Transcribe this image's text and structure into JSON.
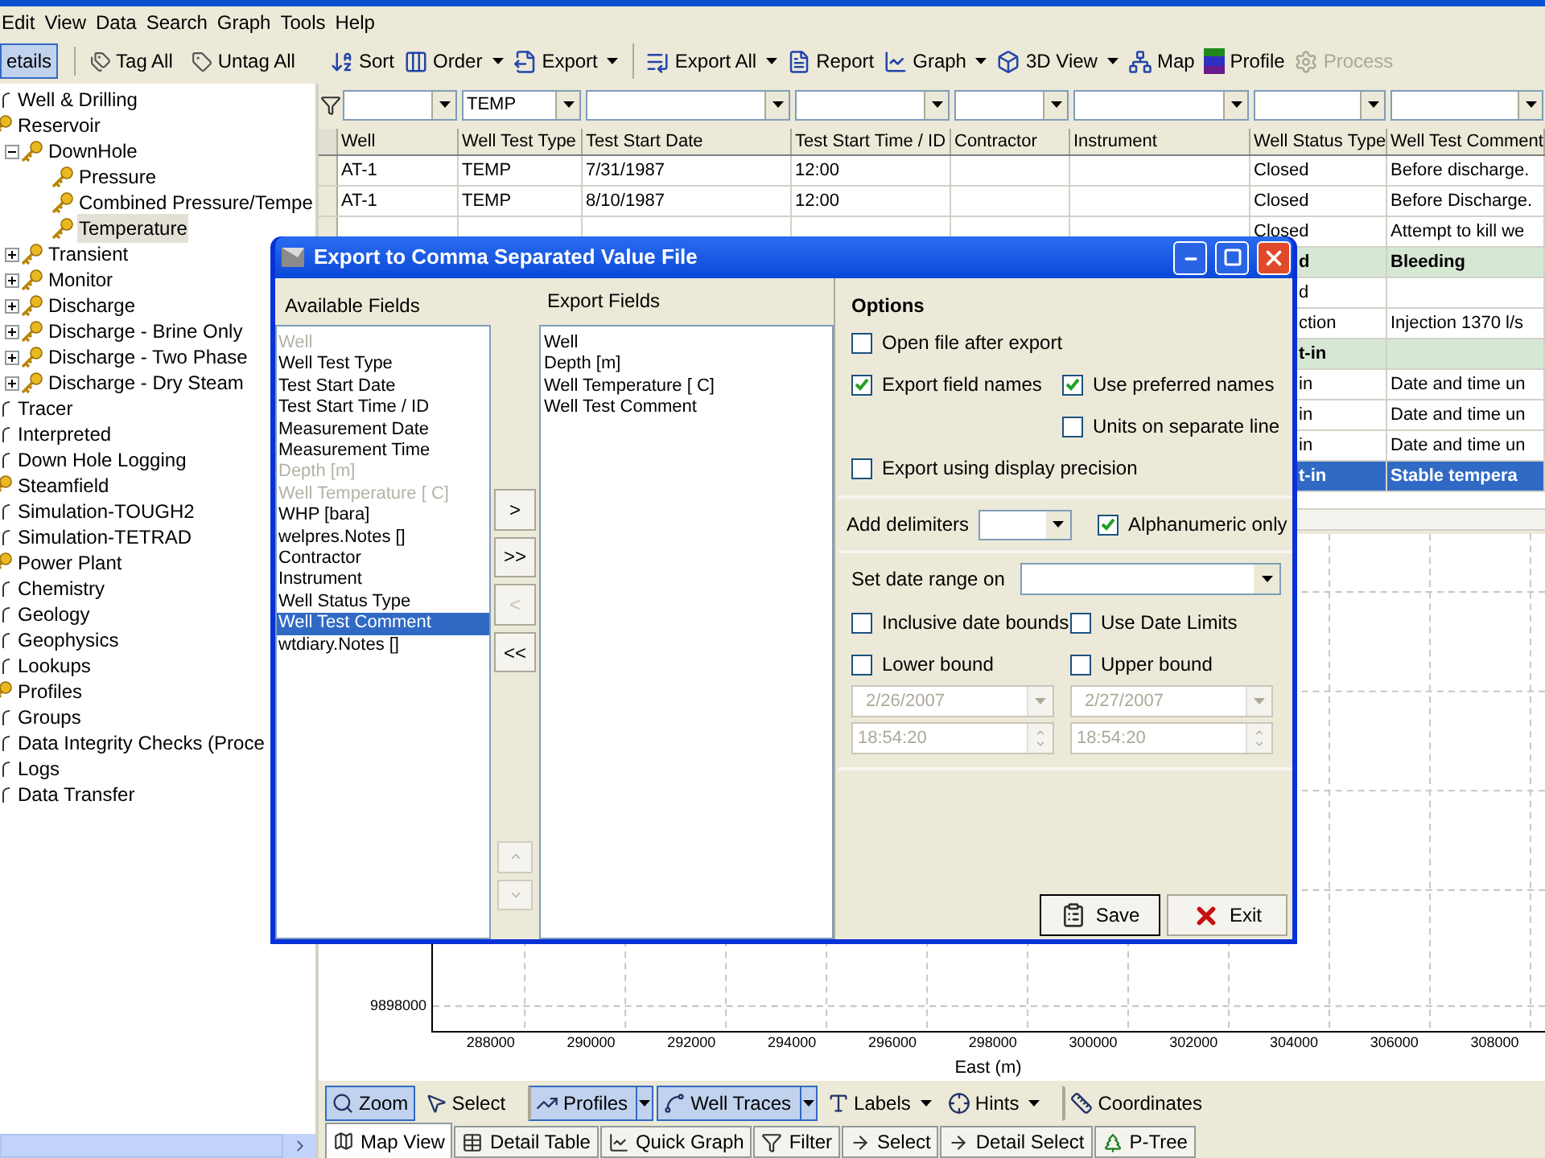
{
  "menu": [
    "Edit",
    "View",
    "Data",
    "Search",
    "Graph",
    "Tools",
    "Help"
  ],
  "side_toolbar": [
    {
      "label": "etails",
      "pressed": true
    },
    {
      "label": "Tag All",
      "pressed": false
    },
    {
      "label": "Untag All",
      "pressed": false
    }
  ],
  "toolbar": [
    {
      "label": "Sort",
      "dropdown": false,
      "disabled": false,
      "separator_before": false
    },
    {
      "label": "Order",
      "dropdown": true,
      "disabled": false,
      "separator_before": false
    },
    {
      "label": "Export",
      "dropdown": true,
      "disabled": false,
      "separator_before": false
    },
    {
      "label": "Export All",
      "dropdown": true,
      "disabled": false,
      "separator_before": true
    },
    {
      "label": "Report",
      "dropdown": false,
      "disabled": false,
      "separator_before": false
    },
    {
      "label": "Graph",
      "dropdown": true,
      "disabled": false,
      "separator_before": false
    },
    {
      "label": "3D View",
      "dropdown": true,
      "disabled": false,
      "separator_before": false
    },
    {
      "label": "Map",
      "dropdown": false,
      "disabled": false,
      "separator_before": false
    },
    {
      "label": "Profile",
      "dropdown": false,
      "disabled": false,
      "separator_before": false
    },
    {
      "label": "Process",
      "dropdown": false,
      "disabled": true,
      "separator_before": false
    }
  ],
  "tree": [
    {
      "label": "Well & Drilling",
      "kind": "branch",
      "selected": false
    },
    {
      "label": "Reservoir",
      "kind": "key",
      "selected": false,
      "children": [
        {
          "label": "DownHole",
          "kind": "key",
          "selected": false,
          "expanded": true,
          "children": [
            {
              "label": "Pressure",
              "kind": "key",
              "selected": false
            },
            {
              "label": "Combined Pressure/Tempe",
              "kind": "key",
              "selected": false
            },
            {
              "label": "Temperature",
              "kind": "key",
              "selected": true
            }
          ]
        },
        {
          "label": "Transient",
          "kind": "key",
          "selected": false,
          "expanded": false
        },
        {
          "label": "Monitor",
          "kind": "key",
          "selected": false,
          "expanded": false
        },
        {
          "label": "Discharge",
          "kind": "key",
          "selected": false,
          "expanded": false
        },
        {
          "label": "Discharge - Brine Only",
          "kind": "key",
          "selected": false,
          "expanded": false
        },
        {
          "label": "Discharge - Two Phase",
          "kind": "key",
          "selected": false,
          "expanded": false
        },
        {
          "label": "Discharge - Dry Steam",
          "kind": "key",
          "selected": false,
          "expanded": false
        }
      ]
    },
    {
      "label": "Tracer",
      "kind": "branch",
      "selected": false
    },
    {
      "label": "Interpreted",
      "kind": "branch",
      "selected": false
    },
    {
      "label": "Down Hole Logging",
      "kind": "branch",
      "selected": false
    },
    {
      "label": "Steamfield",
      "kind": "key",
      "selected": false
    },
    {
      "label": "Simulation-TOUGH2",
      "kind": "branch",
      "selected": false
    },
    {
      "label": "Simulation-TETRAD",
      "kind": "branch",
      "selected": false
    },
    {
      "label": "Power Plant",
      "kind": "key",
      "selected": false
    },
    {
      "label": "Chemistry",
      "kind": "branch",
      "selected": false
    },
    {
      "label": "Geology",
      "kind": "branch",
      "selected": false
    },
    {
      "label": "Geophysics",
      "kind": "branch",
      "selected": false
    },
    {
      "label": "Lookups",
      "kind": "branch",
      "selected": false
    },
    {
      "label": "Profiles",
      "kind": "key",
      "selected": false
    },
    {
      "label": "Groups",
      "kind": "branch",
      "selected": false
    },
    {
      "label": "Data Integrity Checks (Proce",
      "kind": "branch",
      "selected": false
    },
    {
      "label": "Logs",
      "kind": "branch",
      "selected": false
    },
    {
      "label": "Data Transfer",
      "kind": "branch",
      "selected": false
    }
  ],
  "filter_value": "TEMP",
  "table": {
    "columns": [
      "Well",
      "Well Test Type",
      "Test Start Date",
      "Test Start Time / ID",
      "Contractor",
      "Instrument",
      "Well Status Type",
      "Well Test Comment"
    ],
    "rows": [
      {
        "well": "AT-1",
        "test_type": "TEMP",
        "start_date": "7/31/1987",
        "start_time": "12:00",
        "status": "Closed",
        "comment": "Before discharge.",
        "highlight": false,
        "selected": false,
        "covered": false
      },
      {
        "well": "AT-1",
        "test_type": "TEMP",
        "start_date": "8/10/1987",
        "start_time": "12:00",
        "status": "Closed",
        "comment": "Before Discharge.",
        "highlight": false,
        "selected": false,
        "covered": false
      },
      {
        "status": "Closed",
        "comment": "Attempt to kill we",
        "highlight": false,
        "selected": false,
        "covered": false
      },
      {
        "status": "d",
        "comment": "Bleeding",
        "highlight": true,
        "selected": false,
        "covered": true
      },
      {
        "status": "d",
        "highlight": false,
        "selected": false,
        "covered": true
      },
      {
        "status": "ction",
        "comment": "Injection 1370 l/s",
        "highlight": false,
        "selected": false,
        "covered": true
      },
      {
        "status": "t-in",
        "highlight": true,
        "selected": false,
        "covered": true
      },
      {
        "status": "in",
        "comment": "Date and time un",
        "highlight": false,
        "selected": false,
        "covered": true
      },
      {
        "status": "in",
        "comment": "Date and time un",
        "highlight": false,
        "selected": false,
        "covered": true
      },
      {
        "status": "in",
        "comment": "Date and time un",
        "highlight": false,
        "selected": false,
        "covered": true
      },
      {
        "status": "t-in",
        "comment": "Stable tempera",
        "selected": true,
        "covered": true
      }
    ]
  },
  "plot": {
    "x_ticks": [
      "288000",
      "290000",
      "292000",
      "294000",
      "296000",
      "298000",
      "300000",
      "302000",
      "304000",
      "306000",
      "308000"
    ],
    "y_ticks": [
      "9898000"
    ],
    "x_label": "East (m)"
  },
  "map_toolbar": [
    {
      "label": "Zoom",
      "pressed": true,
      "dropdown": false,
      "split": false,
      "separator_before": false
    },
    {
      "label": "Select",
      "pressed": false,
      "dropdown": false,
      "split": false,
      "separator_before": false
    },
    {
      "label": "Profiles",
      "pressed": true,
      "dropdown": false,
      "split": true,
      "separator_before": true
    },
    {
      "label": "Well Traces",
      "pressed": true,
      "dropdown": false,
      "split": true,
      "separator_before": false
    },
    {
      "label": "Labels",
      "pressed": false,
      "dropdown": true,
      "split": false,
      "separator_before": false
    },
    {
      "label": "Hints",
      "pressed": false,
      "dropdown": true,
      "split": false,
      "separator_before": false
    },
    {
      "label": "Coordinates",
      "pressed": false,
      "dropdown": false,
      "split": false,
      "separator_before": true
    }
  ],
  "tabs": [
    {
      "label": "Map View",
      "selected": true
    },
    {
      "label": "Detail Table",
      "selected": false
    },
    {
      "label": "Quick Graph",
      "selected": false
    },
    {
      "label": "Filter",
      "selected": false
    },
    {
      "label": "Select",
      "selected": false
    },
    {
      "label": "Detail Select",
      "selected": false
    },
    {
      "label": "P-Tree",
      "selected": false
    }
  ],
  "dialog": {
    "title": "Export to Comma Separated Value File",
    "available": {
      "title": "Available Fields",
      "items": [
        {
          "label": "Well",
          "disabled": true,
          "selected": false
        },
        {
          "label": "Well Test Type",
          "disabled": false,
          "selected": false
        },
        {
          "label": "Test Start Date",
          "disabled": false,
          "selected": false
        },
        {
          "label": "Test Start Time / ID",
          "disabled": false,
          "selected": false
        },
        {
          "label": "Measurement Date",
          "disabled": false,
          "selected": false
        },
        {
          "label": "Measurement Time",
          "disabled": false,
          "selected": false
        },
        {
          "label": "Depth [m]",
          "disabled": true,
          "selected": false
        },
        {
          "label": "Well Temperature [ C]",
          "disabled": true,
          "selected": false
        },
        {
          "label": "WHP [bara]",
          "disabled": false,
          "selected": false
        },
        {
          "label": "welpres.Notes []",
          "disabled": false,
          "selected": false
        },
        {
          "label": "Contractor",
          "disabled": false,
          "selected": false
        },
        {
          "label": "Instrument",
          "disabled": false,
          "selected": false
        },
        {
          "label": "Well Status Type",
          "disabled": false,
          "selected": false
        },
        {
          "label": "Well Test Comment",
          "disabled": false,
          "selected": true
        },
        {
          "label": "wtdiary.Notes []",
          "disabled": false,
          "selected": false
        }
      ]
    },
    "move_buttons": [
      {
        "label": ">",
        "disabled": false
      },
      {
        "label": ">>",
        "disabled": false
      },
      {
        "label": "<",
        "disabled": true
      },
      {
        "label": "<<",
        "disabled": false
      }
    ],
    "order_buttons": [
      {
        "kind": "up",
        "disabled": true
      },
      {
        "kind": "down",
        "disabled": true
      }
    ],
    "export": {
      "title": "Export Fields",
      "items": [
        "Well",
        "Depth [m]",
        "Well Temperature [ C]",
        "Well Test Comment"
      ]
    },
    "options": {
      "title": "Options",
      "open_file": {
        "label": "Open file after export",
        "checked": false
      },
      "field_names": {
        "label": "Export field names",
        "checked": true
      },
      "preferred_names": {
        "label": "Use preferred names",
        "checked": true
      },
      "units_line": {
        "label": "Units on separate line",
        "checked": false
      },
      "display_precision": {
        "label": "Export using display precision",
        "checked": false
      },
      "delimiters_label": "Add delimiters",
      "alphanumeric": {
        "label": "Alphanumeric only",
        "checked": true
      },
      "date_range_label": "Set date range on",
      "inclusive": {
        "label": "Inclusive date bounds",
        "checked": false
      },
      "date_limits": {
        "label": "Use Date Limits",
        "checked": false
      },
      "lower": {
        "label": "Lower bound",
        "checked": false,
        "date": "2/26/2007",
        "time": "18:54:20",
        "disabled": true
      },
      "upper": {
        "label": "Upper bound",
        "checked": false,
        "date": "2/27/2007",
        "time": "18:54:20",
        "disabled": true
      }
    },
    "save": "Save",
    "exit": "Exit"
  }
}
